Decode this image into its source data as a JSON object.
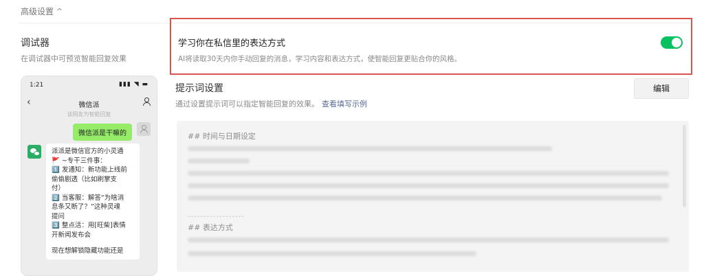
{
  "header": {
    "advanced_label": "高级设置",
    "chevron": "chevron-up-icon"
  },
  "debugger": {
    "title": "调试器",
    "subtitle": "在调试器中可预览智能回复效果",
    "phone": {
      "time": "1:21",
      "signal": "▮▮▮ ◥ ▬",
      "nav_title": "微信派",
      "hint": "该网友为智能回复",
      "user_message": "微信派是干嘛的",
      "bot_reply": [
        "派派是微信官方的小灵通",
        "🚩 ~专干三件事：",
        "1️⃣ 发通知：新功能上线前",
        "偷偷剧透（比如刷掌支",
        "付）",
        "2️⃣ 当客服：解答“为啥消",
        "息条又断了？”这种灵魂",
        "提问",
        "3️⃣ 整点活：用[旺柴]表情",
        "开新闻发布会",
        "",
        "现在想解锁隐藏功能还是"
      ]
    }
  },
  "learn_style": {
    "title": "学习你在私信里的表达方式",
    "description": "AI将读取30天内你手动回复的消息，学习内容和表达方式，使智能回复更贴合你的风格。",
    "enabled": true,
    "toggle_color": "#07c160"
  },
  "prompt": {
    "title": "提示词设置",
    "description": "通过设置提示词可以指定智能回复的效果。",
    "example_link": "查看填写示例",
    "edit_label": "编辑",
    "section1_heading": "## 时间与日期设定",
    "divider": "------------------",
    "section2_heading": "## 表达方式"
  },
  "colors": {
    "highlight": "#d9534f",
    "link": "#576b95"
  }
}
